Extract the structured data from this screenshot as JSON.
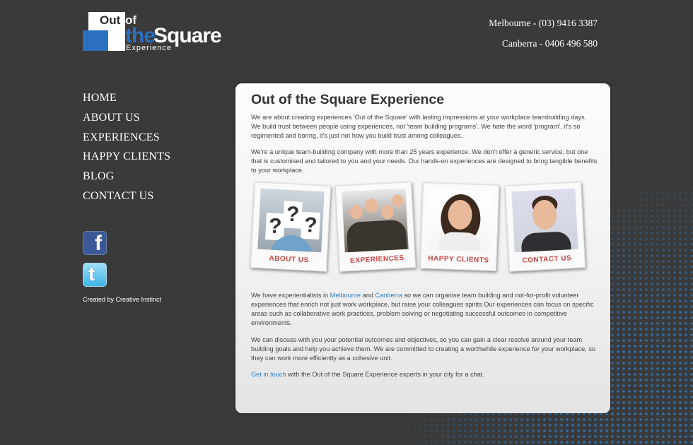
{
  "logo": {
    "out": "Out",
    "of": "of",
    "the": "the",
    "square": "Square",
    "experience": "Experience"
  },
  "contacts": {
    "melbourne": "Melbourne - (03) 9416 3387",
    "canberra": "Canberra - 0406 496 580"
  },
  "nav": [
    "HOME",
    "ABOUT US",
    "EXPERIENCES",
    "HAPPY CLIENTS",
    "BLOG",
    "CONTACT US"
  ],
  "social": {
    "facebook_letter": "f",
    "twitter_letter": "t"
  },
  "credit": "Created by Creative Instinct",
  "main": {
    "title": "Out of the Square Experience",
    "para1": "We are about creating experiences 'Out of the Square' with lasting impressions at your workplace teambuilding days. We build trust between people using experiences, not 'team building programs'. We hate the word 'program', it's so regimented and boring, it's just not how you build trust among colleagues.",
    "para2": "We're a unique team-building company with more than 25 years experience. We don't offer a generic service, but one that is customised and tailored to you and your needs. Our hands-on experiences are designed to bring tangible benefits to your workplace.",
    "polaroids": [
      "ABOUT US",
      "EXPERIENCES",
      "HAPPY CLIENTS",
      "CONTACT US"
    ],
    "para3_a": "We have experientialists in ",
    "para3_link1": "Melbourne",
    "para3_b": " and ",
    "para3_link2": "Canberra",
    "para3_c": " so we can organise team building and not-for-profit volunteer experiences that enrich not just work workplace, but raise your colleagues spirits Our experiences can focus on specific areas such as collaborative work practices, problem solving or negotiating successful outcomes in competitive environments.",
    "para4": "We can discuss with you your potential outcomes and objectives, so you can gain a clear resolve around your team building goals and help you achieve them. We are committed to creating a worthwhile experience for your workplace, so they can work more efficiently as a cohesive unit.",
    "para5_link": "Get in touch",
    "para5_rest": " with the Out of the Square Experience experts in your city for a chat."
  }
}
